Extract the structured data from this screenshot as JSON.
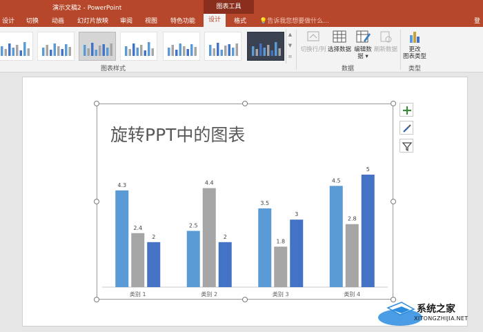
{
  "titlebar": {
    "doc_title": "演示文稿2 - PowerPoint",
    "context_tab": "图表工具"
  },
  "tabs": [
    "设计",
    "切换",
    "动画",
    "幻灯片放映",
    "审阅",
    "视图",
    "特色功能"
  ],
  "active_tab": "设计",
  "format_tab": "格式",
  "tell_me": "告诉我您想要做什么...",
  "login": "登",
  "ribbon": {
    "group_chart_styles": "图表样式",
    "group_data": "数据",
    "group_type": "类型",
    "switch_row_col": "切换行/列",
    "select_data": "选择数据",
    "edit_data_line1": "编辑数",
    "edit_data_line2": "据 ▾",
    "refresh_data": "刷新数据",
    "change_type_line1": "更改",
    "change_type_line2": "图表类型",
    "gallery_up": "▲",
    "gallery_down": "▼",
    "gallery_more": "≡"
  },
  "colors": {
    "accent": "#b7472a",
    "series1": "#5b9bd5",
    "series2": "#a5a5a5",
    "series3": "#4472c4"
  },
  "icons": [
    "plus-icon",
    "brush-icon",
    "filter-icon"
  ],
  "chart_data": {
    "type": "bar",
    "title": "旋转PPT中的图表",
    "categories": [
      "类别 1",
      "类别 2",
      "类别 3",
      "类别 4"
    ],
    "series": [
      {
        "values": [
          4.3,
          2.5,
          3.5,
          4.5
        ]
      },
      {
        "values": [
          2.4,
          4.4,
          1.8,
          2.8
        ]
      },
      {
        "values": [
          2,
          2,
          3,
          5
        ]
      }
    ],
    "data_labels": [
      [
        "4.3",
        "2.5",
        "3.5",
        "4.5"
      ],
      [
        "2.4",
        "4.4",
        "1.8",
        "2.8"
      ],
      [
        "2",
        "2",
        "3",
        "5"
      ]
    ],
    "ylim": [
      0,
      5
    ],
    "grid": false,
    "legend": "none"
  },
  "watermark": {
    "title": "系统之家",
    "subtitle": "XITONGZHIJIA.NET"
  }
}
